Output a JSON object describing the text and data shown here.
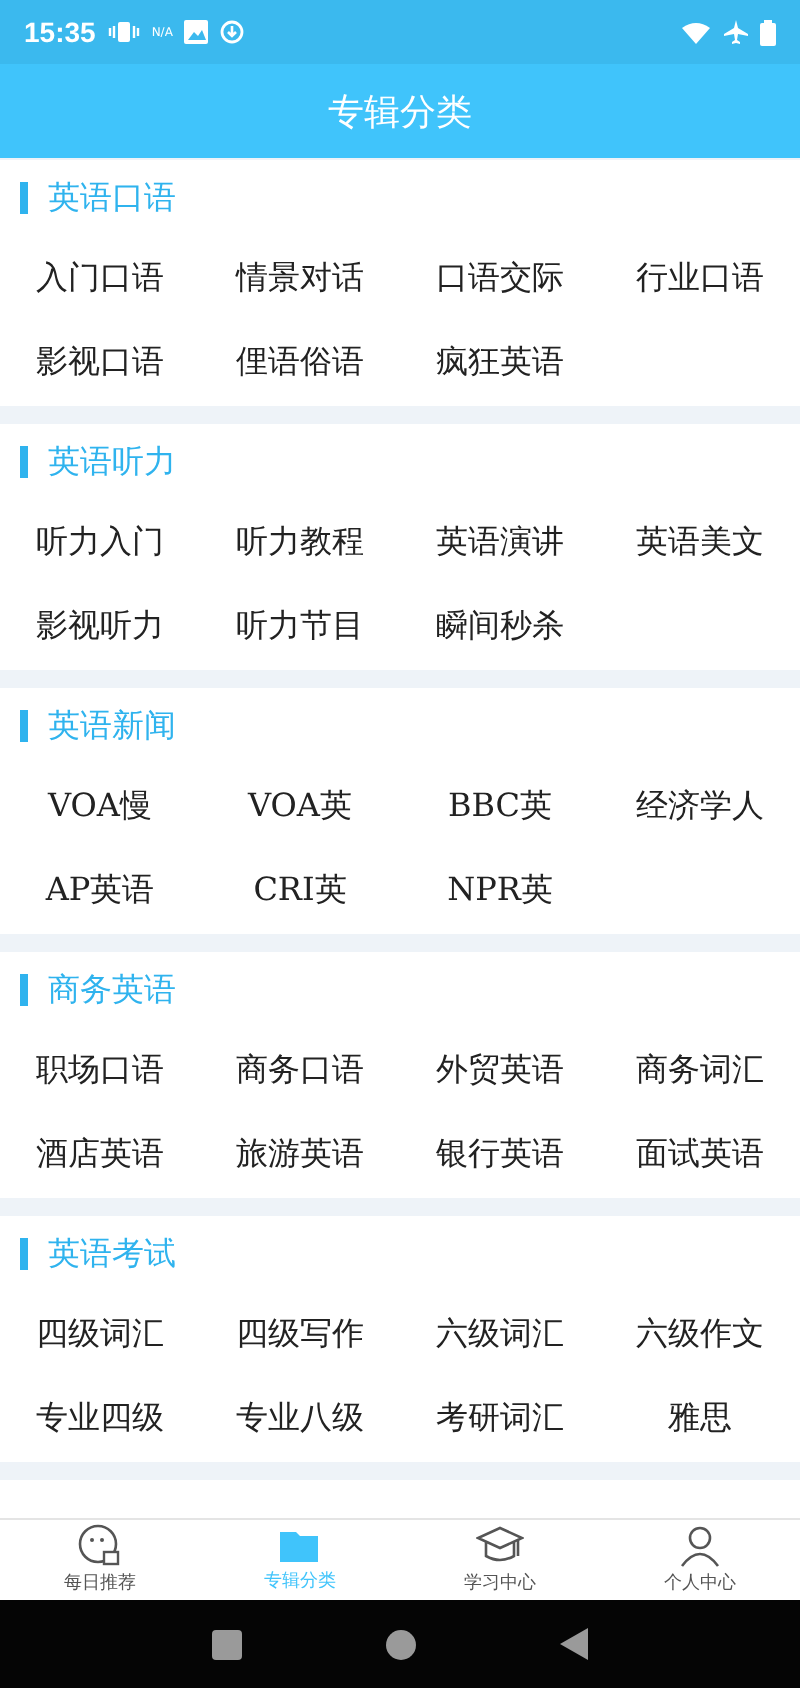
{
  "status_bar": {
    "time": "15:35",
    "network_label": "N/A"
  },
  "header": {
    "title": "专辑分类"
  },
  "sections": [
    {
      "title": "英语口语",
      "items": [
        "入门口语",
        "情景对话",
        "口语交际",
        "行业口语",
        "影视口语",
        "俚语俗语",
        "疯狂英语"
      ]
    },
    {
      "title": "英语听力",
      "items": [
        "听力入门",
        "听力教程",
        "英语演讲",
        "英语美文",
        "影视听力",
        "听力节目",
        "瞬间秒杀"
      ]
    },
    {
      "title": "英语新闻",
      "items": [
        "VOA慢",
        "VOA英",
        "BBC英",
        "经济学人",
        "AP英语",
        "CRI英",
        "NPR英"
      ]
    },
    {
      "title": "商务英语",
      "items": [
        "职场口语",
        "商务口语",
        "外贸英语",
        "商务词汇",
        "酒店英语",
        "旅游英语",
        "银行英语",
        "面试英语"
      ]
    },
    {
      "title": "英语考试",
      "items": [
        "四级词汇",
        "四级写作",
        "六级词汇",
        "六级作文",
        "专业四级",
        "专业八级",
        "考研词汇",
        "雅思"
      ]
    }
  ],
  "tabs": [
    {
      "label": "每日推荐",
      "kind": "daily",
      "selected": false
    },
    {
      "label": "专辑分类",
      "kind": "album",
      "selected": true
    },
    {
      "label": "学习中心",
      "kind": "study",
      "selected": false
    },
    {
      "label": "个人中心",
      "kind": "profile",
      "selected": false
    }
  ]
}
